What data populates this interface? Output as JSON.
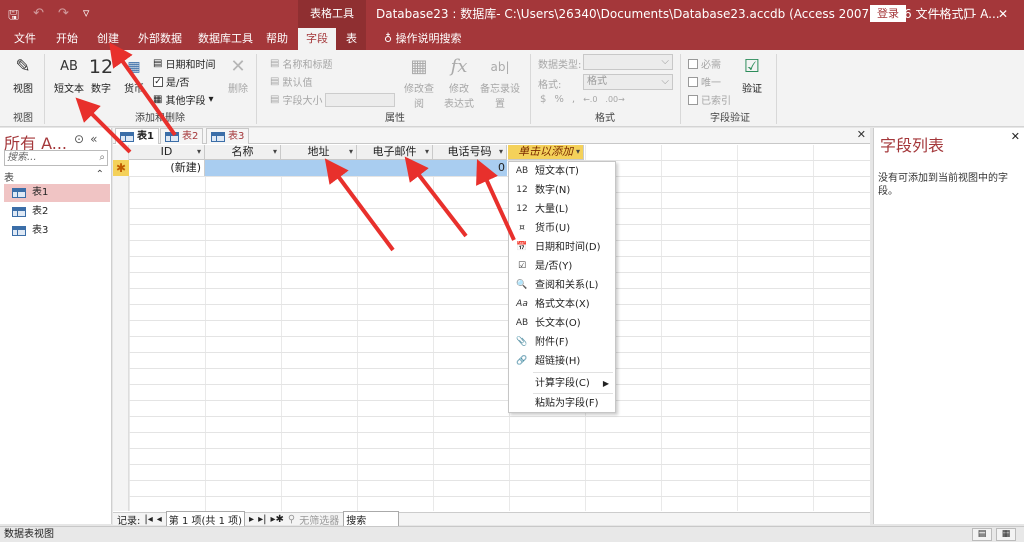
{
  "titlebar": {
    "qat": [
      "🖫",
      "↶",
      "↷",
      "▿"
    ],
    "context_tools": "表格工具",
    "title": "Database23 : 数据库- C:\\Users\\26340\\Documents\\Database23.accdb (Access 2007 - 2016 文件格式) - A...",
    "login": "登录",
    "win_buttons": [
      "—",
      "❐",
      "✕"
    ]
  },
  "tabs": {
    "file": "文件",
    "home": "开始",
    "create": "创建",
    "external": "外部数据",
    "dbtools": "数据库工具",
    "help": "帮助",
    "fields": "字段",
    "table": "表",
    "tellme": "操作说明搜索"
  },
  "ribbon": {
    "views": {
      "btn": "视图",
      "group": "视图"
    },
    "add_delete": {
      "short_text": "短文本",
      "short_text_icon": "AB",
      "number": "数字",
      "number_icon": "12",
      "currency": "货币",
      "datetime": "日期和时间",
      "yesno": "是/否",
      "more": "其他字段",
      "delete": "删除",
      "group": "添加和删除"
    },
    "properties": {
      "name_caption": "名称和标题",
      "default": "默认值",
      "field_size": "字段大小",
      "modify_lookups": "修改查阅",
      "modify_expr_1": "修改",
      "modify_expr_2": "表达式",
      "memo_settings": "备忘录设置",
      "group": "属性"
    },
    "formatting": {
      "data_type": "数据类型:",
      "format": "格式:",
      "format_value": "格式",
      "group": "格式"
    },
    "validation": {
      "required": "必需",
      "unique": "唯一",
      "indexed": "已索引",
      "validation": "验证",
      "group": "字段验证"
    }
  },
  "nav": {
    "title": "所有 A...",
    "search_placeholder": "搜索...",
    "category": "表",
    "items": [
      "表1",
      "表2",
      "表3"
    ]
  },
  "doc": {
    "tabs": [
      "表1",
      "表2",
      "表3"
    ],
    "columns": [
      "ID",
      "名称",
      "地址",
      "电子邮件",
      "电话号码"
    ],
    "add_column": "单击以添加",
    "new_row_label": "(新建)",
    "new_row_value": "0"
  },
  "menu": {
    "items": [
      {
        "icon": "AB",
        "label": "短文本(T)"
      },
      {
        "icon": "12",
        "label": "数字(N)"
      },
      {
        "icon": "12",
        "label": "大量(L)"
      },
      {
        "icon": "¤",
        "label": "货币(U)"
      },
      {
        "icon": "📅",
        "label": "日期和时间(D)"
      },
      {
        "icon": "☑",
        "label": "是/否(Y)"
      },
      {
        "icon": "🔍",
        "label": "查阅和关系(L)"
      },
      {
        "icon": "Aa",
        "label": "格式文本(X)"
      },
      {
        "icon": "AB",
        "label": "长文本(O)"
      },
      {
        "icon": "📎",
        "label": "附件(F)"
      },
      {
        "icon": "🔗",
        "label": "超链接(H)"
      },
      {
        "icon": "",
        "label": "计算字段(C)"
      },
      {
        "icon": "",
        "label": "粘贴为字段(F)"
      }
    ]
  },
  "recnav": {
    "label": "记录:",
    "position": "第 1 项(共 1 项)",
    "filter": "无筛选器",
    "search": "搜索"
  },
  "fieldlist": {
    "title": "字段列表",
    "message": "没有可添加到当前视图中的字段。"
  },
  "status": {
    "text": "数据表视图"
  },
  "colors": {
    "accent": "#a4373a",
    "highlight": "#f4d15a",
    "selection": "#a9cdf0",
    "arrow": "#e8302c"
  }
}
